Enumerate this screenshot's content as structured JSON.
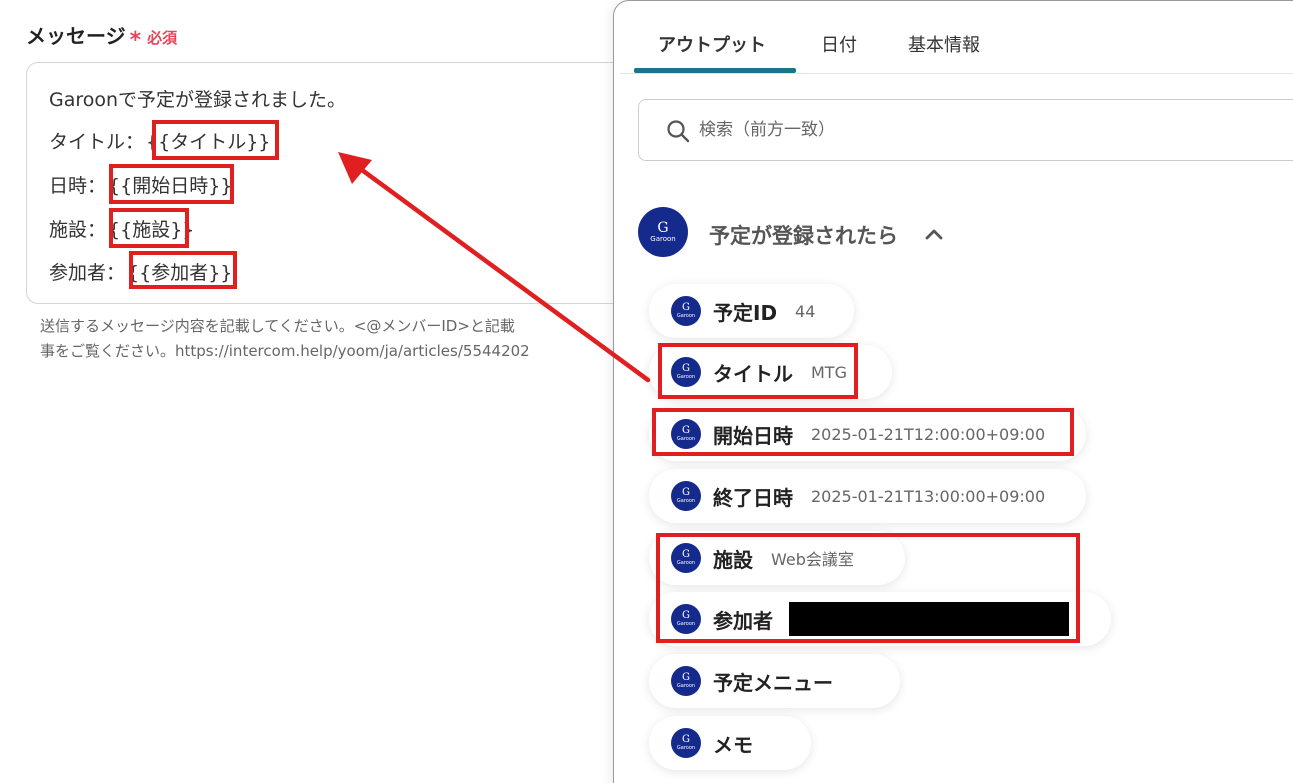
{
  "field": {
    "label": "メッセージ",
    "asterisk": "*",
    "required": "必須"
  },
  "message": {
    "line1": "Garoonで予定が登録されました。",
    "title_label": "タイトル：",
    "title_var": "{{タイトル}}",
    "date_label": "日時：",
    "date_var": "{{開始日時}}",
    "facility_label": "施設：",
    "facility_var": "{{施設}}",
    "attendee_label": "参加者：",
    "attendee_var": "{{参加者}}"
  },
  "hint": {
    "line1": "送信するメッセージ内容を記載してください。<@メンバーID>と記載",
    "line2": "事をご覧ください。https://intercom.help/yoom/ja/articles/5544202"
  },
  "tabs": [
    {
      "label": "アウトプット",
      "active": true
    },
    {
      "label": "日付",
      "active": false
    },
    {
      "label": "基本情報",
      "active": false
    }
  ],
  "search": {
    "placeholder": "検索（前方一致）"
  },
  "section": {
    "title": "予定が登録されたら",
    "logo_letter": "G",
    "logo_text": "Garoon"
  },
  "outputs": [
    {
      "label": "予定ID",
      "value": "44"
    },
    {
      "label": "タイトル",
      "value": "MTG"
    },
    {
      "label": "開始日時",
      "value": "2025-01-21T12:00:00+09:00"
    },
    {
      "label": "終了日時",
      "value": "2025-01-21T13:00:00+09:00"
    },
    {
      "label": "施設",
      "value": "Web会議室"
    },
    {
      "label": "参加者",
      "value": ""
    },
    {
      "label": "予定メニュー",
      "value": ""
    },
    {
      "label": "メモ",
      "value": ""
    }
  ],
  "colors": {
    "accent": "#1a7588",
    "required": "#e5475a",
    "highlight": "#e02020",
    "garoon": "#142a8c"
  }
}
